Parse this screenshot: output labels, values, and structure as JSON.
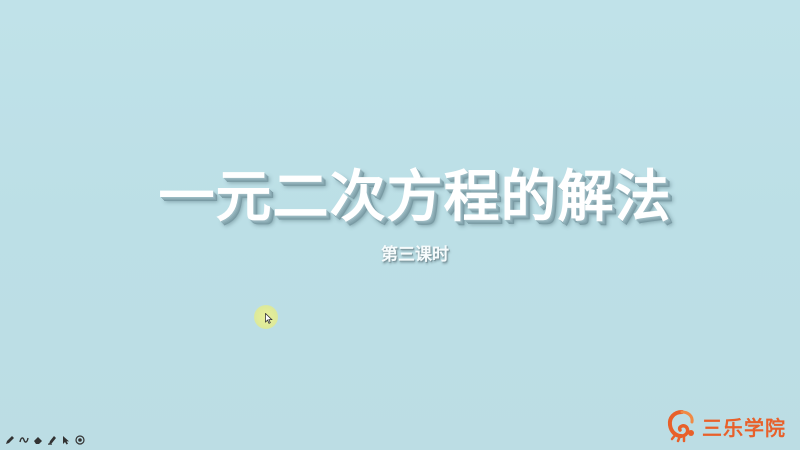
{
  "slide": {
    "title": "一元二次方程的解法",
    "subtitle": "第三课时",
    "background_color": "#bde0e7",
    "title_color": "#ffffff"
  },
  "toolbar": {
    "tools": [
      {
        "icon": "pen-icon"
      },
      {
        "icon": "freehand-icon"
      },
      {
        "icon": "eraser-icon"
      },
      {
        "icon": "highlighter-icon"
      },
      {
        "icon": "pointer-icon"
      },
      {
        "icon": "record-icon"
      }
    ]
  },
  "logo": {
    "text": "三乐学院",
    "color": "#e8602a"
  }
}
